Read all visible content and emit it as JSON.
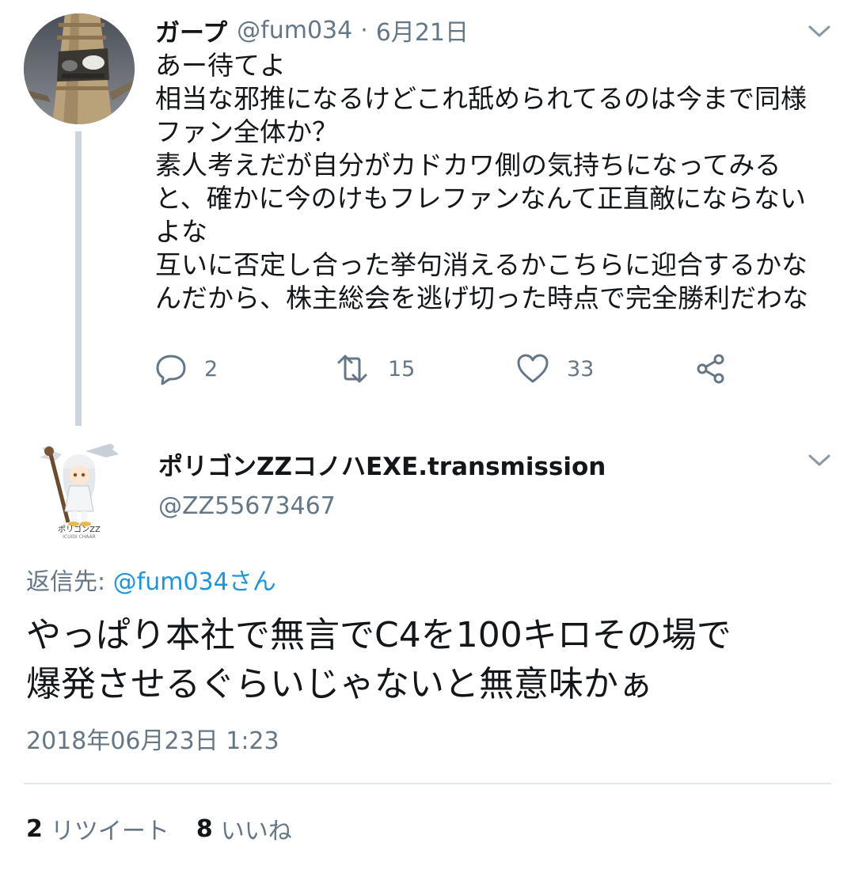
{
  "colors": {
    "text_primary": "#14171a",
    "text_secondary": "#657786",
    "link_blue": "#1b95e0",
    "thread_line": "#ccd6dd",
    "divider": "#e1e8ed"
  },
  "tweet1": {
    "display_name": "ガープ",
    "handle": "@fum034",
    "separator": "·",
    "date": "6月21日",
    "lines": [
      "あー待てよ",
      "相当な邪推になるけどこれ舐められてるのは今まで同様",
      "ファン全体か？",
      "素人考えだが自分がカドカワ側の気持ちになってみる",
      "と、確かに今のけもフレファンなんて正直敵にならない",
      "よな",
      "互いに否定し合った挙句消えるかこちらに迎合するかな",
      "んだから、株主総会を逃げ切った時点で完全勝利だわな"
    ],
    "reply_count": "2",
    "retweet_count": "15",
    "like_count": "33",
    "icons": {
      "reply": "speech-bubble-icon",
      "retweet": "retweet-arrows-icon",
      "like": "heart-icon",
      "share": "share-nodes-icon",
      "menu": "chevron-down-icon"
    }
  },
  "tweet2": {
    "display_name": "ポリゴンZZコノハEXE.transmission",
    "handle": "@ZZ55673467",
    "avatar_caption": "ポリゴンZZ",
    "avatar_subcaption": "ICUIDI CHAAR",
    "reply_to_label": "返信先:",
    "reply_to_mention": "@fum034さん",
    "lines": [
      "やっぱり本社で無言でC4を100キロその場で",
      "爆発させるぐらいじゃないと無意味かぁ"
    ],
    "timestamp": "2018年06月23日 1:23",
    "retweets_num": "2",
    "retweets_label": "リツイート",
    "likes_num": "8",
    "likes_label": "いいね"
  }
}
